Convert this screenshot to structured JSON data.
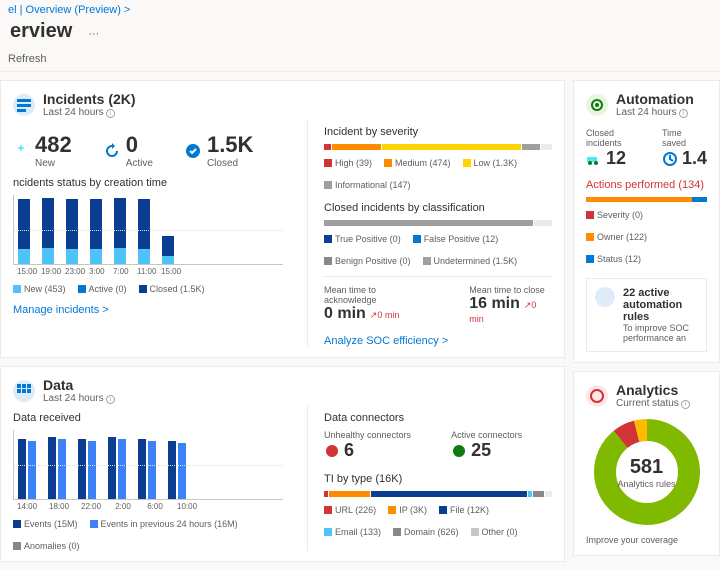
{
  "breadcrumb": "el | Overview (Preview)  >",
  "page_title": "erview",
  "refresh": "Refresh",
  "incidents": {
    "title": "Incidents (2K)",
    "sub": "Last 24 hours",
    "kpi_new": {
      "val": "482",
      "lbl": "New"
    },
    "kpi_active": {
      "val": "0",
      "lbl": "Active"
    },
    "kpi_closed": {
      "val": "1.5K",
      "lbl": "Closed"
    },
    "status_title": "ncidents status by creation time",
    "legend": {
      "new": "New (453)",
      "active": "Active (0)",
      "closed": "Closed (1.5K)"
    },
    "link": "Manage incidents >",
    "sev_title": "Incident by severity",
    "sev": {
      "high": "High (39)",
      "medium": "Medium (474)",
      "low": "Low (1.3K)",
      "info": "Informational (147)"
    },
    "class_title": "Closed incidents by classification",
    "class": {
      "tp": "True Positive (0)",
      "fp": "False Positive (12)",
      "bp": "Benign Positive (0)",
      "und": "Undetermined (1.5K)"
    },
    "mean_ack": {
      "lbl": "Mean time to acknowledge",
      "val": "0 min",
      "delta": "↗0 min"
    },
    "mean_close": {
      "lbl": "Mean time to close",
      "val": "16 min",
      "delta": "↗0 min"
    },
    "soc_link": "Analyze SOC efficiency >"
  },
  "data": {
    "title": "Data",
    "sub": "Last 24 hours",
    "recv_title": "Data received",
    "legend": {
      "ev": "Events (15M)",
      "prev": "Events in previous 24 hours (16M)",
      "anom": "Anomalies (0)"
    },
    "conn_title": "Data connectors",
    "unhealthy": {
      "lbl": "Unhealthy connectors",
      "val": "6"
    },
    "active": {
      "lbl": "Active connectors",
      "val": "25"
    },
    "ti_title": "TI by type (16K)",
    "ti": {
      "url": "URL (226)",
      "ip": "IP (3K)",
      "file": "File (12K)",
      "email": "Email (133)",
      "domain": "Domain (626)",
      "other": "Other (0)"
    }
  },
  "automation": {
    "title": "Automation",
    "sub": "Last 24 hours",
    "closed": {
      "lbl": "Closed incidents",
      "val": "12"
    },
    "saved": {
      "lbl": "Time saved",
      "val": "1.4"
    },
    "actions_title": "Actions performed (134)",
    "actions": {
      "sev": "Severity (0)",
      "owner": "Owner (122)",
      "status": "Status (12)"
    },
    "note_title": "22 active automation rules",
    "note_sub": "To improve SOC performance an"
  },
  "analytics": {
    "title": "Analytics",
    "sub": "Current status",
    "donut_val": "581",
    "donut_lbl": "Analytics rules",
    "cov": "Improve your coverage"
  },
  "chart_data": {
    "incidents_status": {
      "type": "bar",
      "categories": [
        "15:00",
        "19:00",
        "23:00",
        "3:00",
        "7:00",
        "11:00",
        "15:00"
      ],
      "series": [
        {
          "name": "New",
          "color": "#4fc3f7",
          "values": [
            15,
            16,
            15,
            15,
            16,
            15,
            8
          ]
        },
        {
          "name": "Closed",
          "color": "#0b3d91",
          "values": [
            50,
            50,
            50,
            50,
            50,
            50,
            20
          ]
        }
      ],
      "ylim": [
        0,
        70
      ]
    },
    "data_received": {
      "type": "bar",
      "categories": [
        "14:00",
        "18:00",
        "22:00",
        "2:00",
        "6:00",
        "10:00"
      ],
      "series": [
        {
          "name": "Events",
          "color": "#0b3d91",
          "values": [
            60,
            62,
            60,
            62,
            60,
            58
          ]
        },
        {
          "name": "Prev 24h",
          "color": "#3b82f6",
          "values": [
            58,
            60,
            58,
            60,
            58,
            56
          ]
        }
      ],
      "ylim": [
        0,
        70
      ]
    },
    "analytics_donut": {
      "type": "pie",
      "total": 581,
      "series": [
        {
          "name": "Green",
          "value": 520,
          "color": "#7fba00"
        },
        {
          "name": "Red",
          "value": 40,
          "color": "#d13438"
        },
        {
          "name": "Yellow",
          "value": 21,
          "color": "#ffb900"
        }
      ]
    }
  }
}
